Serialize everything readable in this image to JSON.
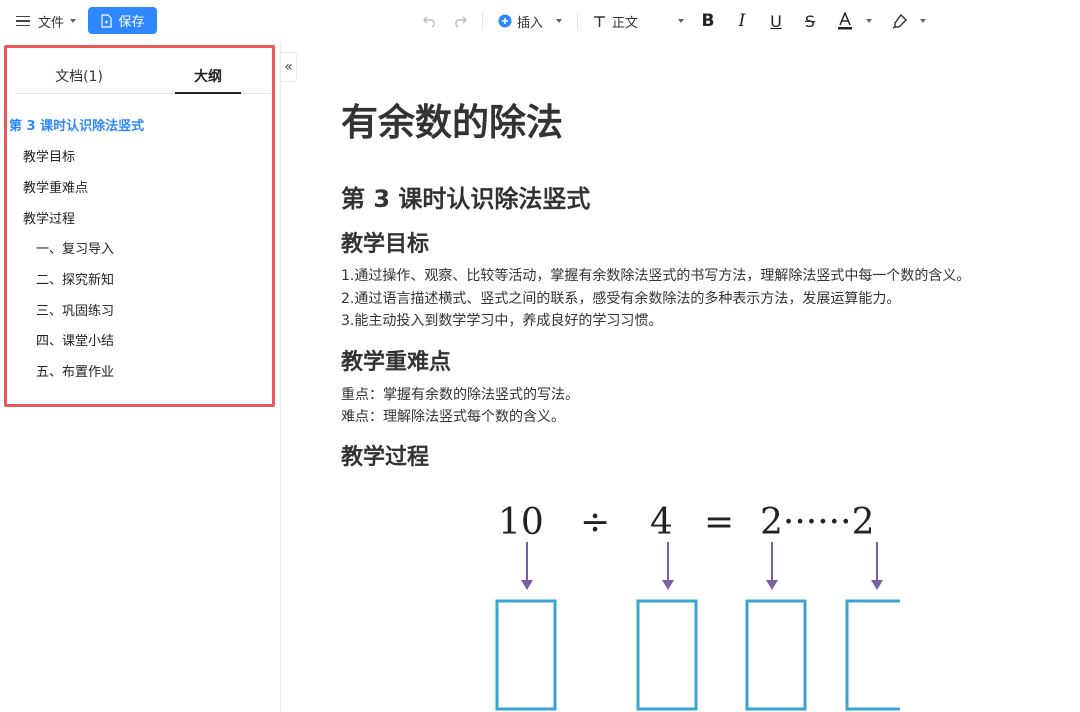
{
  "toolbar": {
    "file_label": "文件",
    "save_label": "保存",
    "insert_label": "插入",
    "style_label": "正文",
    "colors": {
      "accent": "#2f88ff"
    }
  },
  "sidebar": {
    "tabs": [
      {
        "label": "文档(1)",
        "active": false
      },
      {
        "label": "大纲",
        "active": true
      }
    ],
    "outline": [
      {
        "label": "第 3 课时认识除法竖式",
        "active": true
      },
      {
        "label": "教学目标"
      },
      {
        "label": "教学重难点"
      },
      {
        "label": "教学过程"
      },
      {
        "label": "一、复习导入"
      },
      {
        "label": "二、探究新知"
      },
      {
        "label": "三、巩固练习"
      },
      {
        "label": "四、课堂小结"
      },
      {
        "label": "五、布置作业"
      }
    ],
    "collapse_glyph": "«"
  },
  "document": {
    "title": "有余数的除法",
    "lesson_heading": "第 3 课时认识除法竖式",
    "objectives_heading": "教学目标",
    "objectives": [
      "1.通过操作、观察、比较等活动，掌握有余数除法竖式的书写方法，理解除法竖式中每一个数的含义。",
      "2.通过语言描述横式、竖式之间的联系，感受有余数除法的多种表示方法，发展运算能力。",
      "3.能主动投入到数学学习中，养成良好的学习习惯。"
    ],
    "key_points_heading": "教学重难点",
    "key_points": [
      "重点：掌握有余数的除法竖式的写法。",
      "难点：理解除法竖式每个数的含义。"
    ],
    "process_heading": "教学过程",
    "equation": {
      "dividend": "10",
      "operator": "÷",
      "divisor": "4",
      "equals": "=",
      "quotient_remainder": "2······2"
    }
  }
}
